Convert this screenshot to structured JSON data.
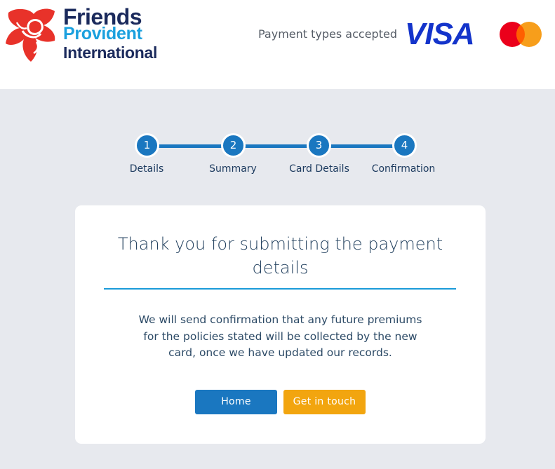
{
  "header": {
    "brand": {
      "line1": "Friends",
      "line2": "Provident",
      "line3": "International"
    },
    "payment_label": "Payment types accepted",
    "visa_text": "VISA",
    "icons": [
      "rose-logo-icon",
      "mastercard-icon"
    ]
  },
  "stepper": {
    "steps": [
      {
        "number": "1",
        "label": "Details"
      },
      {
        "number": "2",
        "label": "Summary"
      },
      {
        "number": "3",
        "label": "Card Details"
      },
      {
        "number": "4",
        "label": "Confirmation"
      }
    ]
  },
  "card": {
    "title": "Thank you for submitting the payment details",
    "message": "We will send confirmation that any future premiums for the policies stated will be collected by the new card, once we have updated our records.",
    "buttons": {
      "home": "Home",
      "contact": "Get in touch"
    }
  },
  "colors": {
    "primary_blue": "#1a77c0",
    "accent_orange": "#f2a50f",
    "brand_red": "#e8322a",
    "brand_navy": "#1b2a5c",
    "brand_cyan": "#1aa0de",
    "page_bg": "#e7e9ee"
  }
}
